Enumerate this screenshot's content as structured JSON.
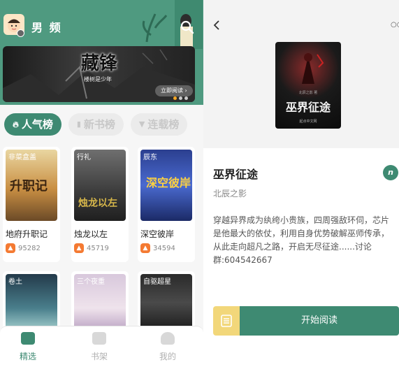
{
  "left": {
    "header": {
      "channel": "男 频",
      "icons": [
        "avatar",
        "search-icon"
      ]
    },
    "banner": {
      "title": "藏锋",
      "subtitle": "楼树是少年",
      "cta": "立即阅读 ›"
    },
    "tabs": [
      {
        "label": "人气榜",
        "icon": "fire-icon",
        "active": true
      },
      {
        "label": "新书榜",
        "icon": "book-icon",
        "active": false
      },
      {
        "label": "连载榜",
        "icon": "shield-icon",
        "active": false
      }
    ],
    "books": [
      {
        "title": "地府升职记",
        "stat": "95282",
        "tag": "非菜盒盖",
        "cover_text": "升职记"
      },
      {
        "title": "烛龙以左",
        "stat": "45719",
        "tag": "行礼",
        "cover_text": "烛龙以左"
      },
      {
        "title": "深空彼岸",
        "stat": "34594",
        "tag": "辰东",
        "cover_text": "深空彼岸"
      }
    ],
    "books_row2": [
      {
        "tag": "卷土"
      },
      {
        "tag": "三个夜重"
      },
      {
        "tag": "自驱超星"
      }
    ],
    "nav": [
      {
        "label": "精选",
        "active": true
      },
      {
        "label": "书架",
        "active": false
      },
      {
        "label": "我的",
        "active": false
      }
    ]
  },
  "right": {
    "cover": {
      "title": "巫界征途",
      "author_small": "北辰之影 著",
      "publisher": "起点中文网"
    },
    "title": "巫界征途",
    "author": "北辰之影",
    "badge": "n",
    "description": "穿越异界成为纨绔小贵族，四周强敌环伺，芯片是他最大的依仗，利用自身优势破解巫师传承，从此走向超凡之路，开启无尽征途......讨论群:604542667",
    "start_label": "开始阅读"
  },
  "colors": {
    "accent": "#3e8a72",
    "fire": "#f47a32",
    "shelf": "#f2d77a"
  }
}
